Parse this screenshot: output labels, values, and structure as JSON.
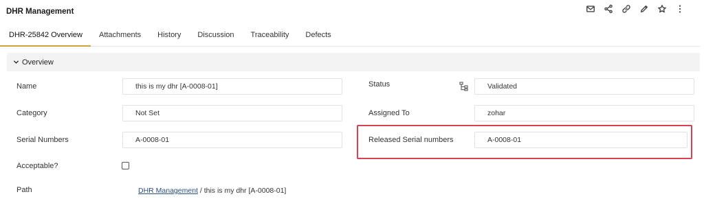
{
  "app": {
    "title": "DHR Management"
  },
  "toolbar": [
    {
      "icon": "mail-icon"
    },
    {
      "icon": "share-icon"
    },
    {
      "icon": "link-icon"
    },
    {
      "icon": "edit-icon"
    },
    {
      "icon": "star-icon"
    },
    {
      "icon": "more-icon"
    }
  ],
  "tabs": [
    {
      "label": "DHR-25842 Overview",
      "active": true
    },
    {
      "label": "Attachments"
    },
    {
      "label": "History"
    },
    {
      "label": "Discussion"
    },
    {
      "label": "Traceability"
    },
    {
      "label": "Defects"
    }
  ],
  "overview": {
    "section_title": "Overview",
    "name": {
      "label": "Name",
      "value": "this is my dhr [A-0008-01]"
    },
    "category": {
      "label": "Category",
      "value": "Not Set"
    },
    "serial_numbers": {
      "label": "Serial Numbers",
      "value": "A-0008-01"
    },
    "acceptable": {
      "label": "Acceptable?",
      "checked": false
    },
    "path": {
      "label": "Path",
      "link": "DHR Management",
      "rest": " / this is my dhr [A-0008-01]"
    },
    "status": {
      "label": "Status",
      "value": "Validated"
    },
    "assigned_to": {
      "label": "Assigned To",
      "value": "zohar"
    },
    "released_serial_numbers": {
      "label": "Released Serial numbers",
      "value": "A-0008-01"
    }
  },
  "colors": {
    "highlight": "#d9414f",
    "active_tab_underline": "#c9a437",
    "link": "#2b4f81",
    "section_bg": "#f3f3f3"
  }
}
